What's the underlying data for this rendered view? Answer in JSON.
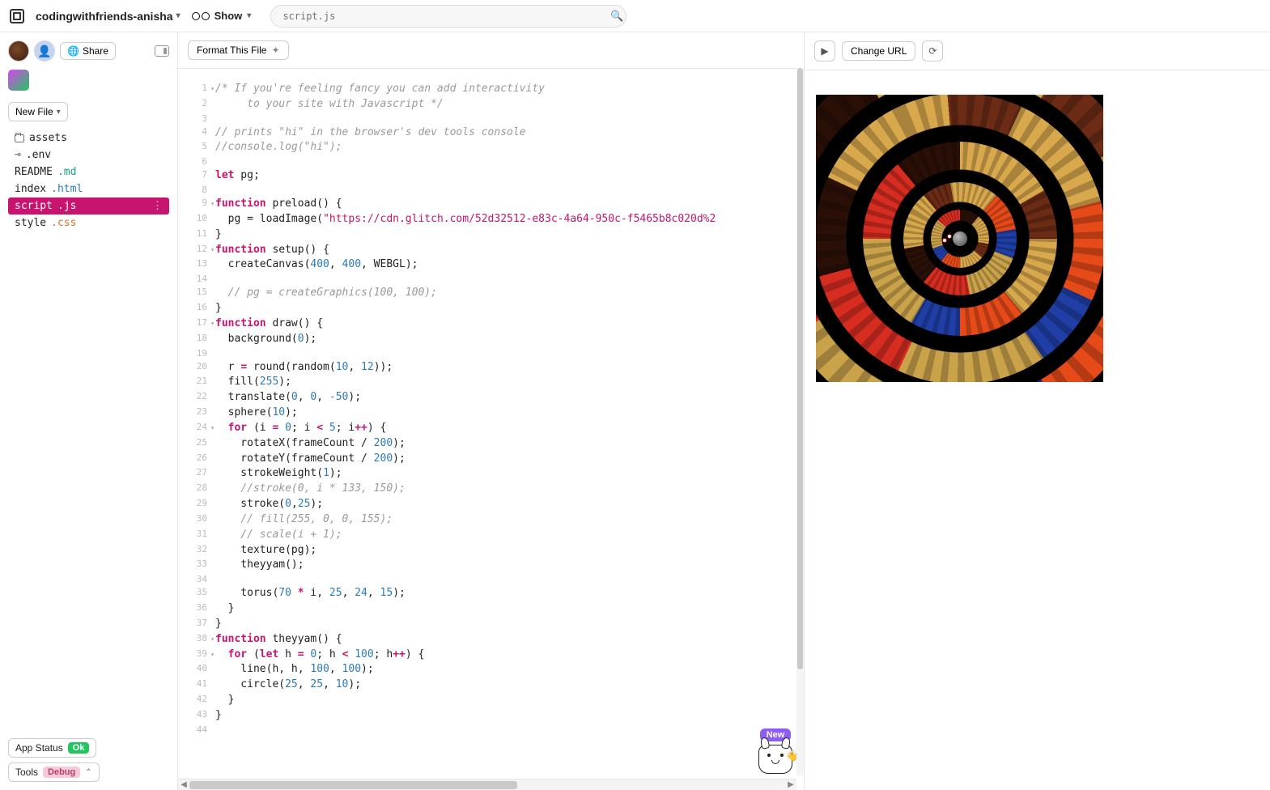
{
  "header": {
    "project_name": "codingwithfriends-anisha",
    "show_label": "Show",
    "search_placeholder": "script.js"
  },
  "sidebar": {
    "share_label": "Share",
    "newfile_label": "New File",
    "files": [
      {
        "icon": "folder",
        "name": "assets",
        "ext": ""
      },
      {
        "icon": "key",
        "name": ".env",
        "ext": ""
      },
      {
        "icon": "none",
        "name": "README",
        "ext": ".md",
        "ext_class": "ext-md"
      },
      {
        "icon": "none",
        "name": "index",
        "ext": ".html",
        "ext_class": "ext-html"
      },
      {
        "icon": "none",
        "name": "script",
        "ext": ".js",
        "ext_class": "ext-js",
        "active": true
      },
      {
        "icon": "none",
        "name": "style",
        "ext": ".css",
        "ext_class": "ext-css"
      }
    ],
    "app_status_label": "App Status",
    "app_status_badge": "Ok",
    "tools_label": "Tools",
    "tools_badge": "Debug"
  },
  "editor": {
    "format_label": "Format This File",
    "mascot_badge": "New",
    "code": [
      {
        "n": 1,
        "fold": true,
        "html": "<span class='cm'>/* If you're feeling fancy you can add interactivity</span>"
      },
      {
        "n": 2,
        "html": "<span class='cm'>     to your site with Javascript */</span>"
      },
      {
        "n": 3,
        "html": ""
      },
      {
        "n": 4,
        "html": "<span class='cm'>// prints \"hi\" in the browser's dev tools console</span>"
      },
      {
        "n": 5,
        "html": "<span class='cm'>//console.log(\"hi\");</span>"
      },
      {
        "n": 6,
        "html": ""
      },
      {
        "n": 7,
        "html": "<span class='kw'>let</span> pg;"
      },
      {
        "n": 8,
        "html": ""
      },
      {
        "n": 9,
        "fold": true,
        "html": "<span class='kw'>function</span> <span class='fn'>preload</span>() {"
      },
      {
        "n": 10,
        "html": "  pg = loadImage(<span class='str'>\"https://cdn.glitch.com/52d32512-e83c-4a64-950c-f5465b8c020d%2</span>"
      },
      {
        "n": 11,
        "html": "}"
      },
      {
        "n": 12,
        "fold": true,
        "html": "<span class='kw'>function</span> <span class='fn'>setup</span>() {"
      },
      {
        "n": 13,
        "html": "  createCanvas(<span class='num'>400</span>, <span class='num'>400</span>, WEBGL);"
      },
      {
        "n": 14,
        "html": ""
      },
      {
        "n": 15,
        "html": "  <span class='cm'>// pg = createGraphics(100, 100);</span>"
      },
      {
        "n": 16,
        "html": "}"
      },
      {
        "n": 17,
        "fold": true,
        "html": "<span class='kw'>function</span> <span class='fn'>draw</span>() {"
      },
      {
        "n": 18,
        "html": "  background(<span class='num'>0</span>);"
      },
      {
        "n": 19,
        "html": ""
      },
      {
        "n": 20,
        "html": "  r <span class='kw'>=</span> round(random(<span class='num'>10</span>, <span class='num'>12</span>));"
      },
      {
        "n": 21,
        "html": "  fill(<span class='num'>255</span>);"
      },
      {
        "n": 22,
        "html": "  translate(<span class='num'>0</span>, <span class='num'>0</span>, <span class='num'>-50</span>);"
      },
      {
        "n": 23,
        "html": "  sphere(<span class='num'>10</span>);"
      },
      {
        "n": 24,
        "fold": true,
        "html": "  <span class='kw'>for</span> (i <span class='kw'>=</span> <span class='num'>0</span>; i <span class='kw'>&lt;</span> <span class='num'>5</span>; i<span class='kw'>++</span>) {"
      },
      {
        "n": 25,
        "html": "    rotateX(frameCount / <span class='num'>200</span>);"
      },
      {
        "n": 26,
        "html": "    rotateY(frameCount / <span class='num'>200</span>);"
      },
      {
        "n": 27,
        "html": "    strokeWeight(<span class='num'>1</span>);"
      },
      {
        "n": 28,
        "html": "    <span class='cm'>//stroke(0, i * 133, 150);</span>"
      },
      {
        "n": 29,
        "html": "    stroke(<span class='num'>0</span>,<span class='num'>25</span>);"
      },
      {
        "n": 30,
        "html": "    <span class='cm'>// fill(255, 0, 0, 155);</span>"
      },
      {
        "n": 31,
        "html": "    <span class='cm'>// scale(i + 1);</span>"
      },
      {
        "n": 32,
        "html": "    texture(pg);"
      },
      {
        "n": 33,
        "html": "    theyyam();"
      },
      {
        "n": 34,
        "html": ""
      },
      {
        "n": 35,
        "html": "    torus(<span class='num'>70</span> <span class='kw'>*</span> i, <span class='num'>25</span>, <span class='num'>24</span>, <span class='num'>15</span>);"
      },
      {
        "n": 36,
        "html": "  }"
      },
      {
        "n": 37,
        "html": "}"
      },
      {
        "n": 38,
        "fold": true,
        "html": "<span class='kw'>function</span> <span class='fn'>theyyam</span>() {"
      },
      {
        "n": 39,
        "fold": true,
        "html": "  <span class='kw'>for</span> (<span class='kw'>let</span> h <span class='kw'>=</span> <span class='num'>0</span>; h <span class='kw'>&lt;</span> <span class='num'>100</span>; h<span class='kw'>++</span>) {"
      },
      {
        "n": 40,
        "html": "    line(h, h, <span class='num'>100</span>, <span class='num'>100</span>);"
      },
      {
        "n": 41,
        "html": "    circle(<span class='num'>25</span>, <span class='num'>25</span>, <span class='num'>10</span>);"
      },
      {
        "n": 42,
        "html": "  }"
      },
      {
        "n": 43,
        "html": "}"
      },
      {
        "n": 44,
        "html": ""
      }
    ]
  },
  "preview": {
    "change_url_label": "Change URL"
  }
}
